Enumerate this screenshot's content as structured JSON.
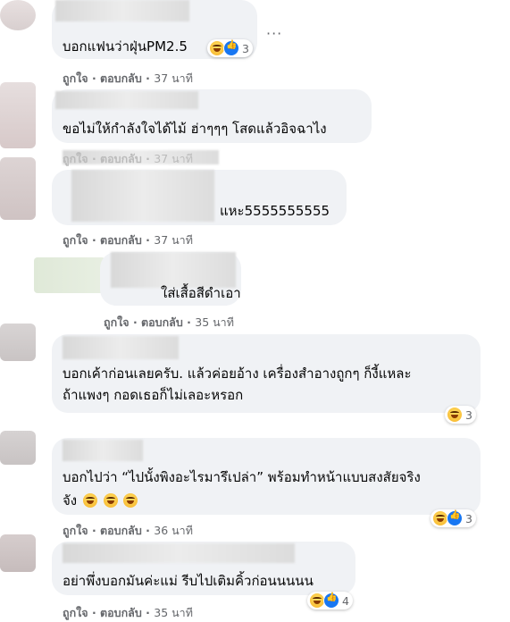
{
  "colors": {
    "bubble": "#f0f2f5",
    "meta": "#65676b",
    "like_blue": "#1877f2",
    "haha_yellow": "#f7b125"
  },
  "comments": [
    {
      "text": "บอกแฟนว่าฝุ่นPM2.5",
      "like_label": "ถูกใจ",
      "reply_label": "ตอบกลับ",
      "time": "37 นาที",
      "reactions": {
        "icons": [
          "haha-icon",
          "like-icon"
        ],
        "count": "3"
      }
    },
    {
      "text": "ขอไม่ให้กำลังใจได้ไม้ ฮ่าๆๆๆ โสดแล้วอิจฉาไง",
      "like_label": "ถูกใจ",
      "reply_label": "ตอบกลับ",
      "time": "37 นาที"
    },
    {
      "text": "แหะ5555555555",
      "like_label": "ถูกใจ",
      "reply_label": "ตอบกลับ",
      "time": "37 นาที"
    },
    {
      "text": "ใส่เสื้อสีดำเอา",
      "like_label": "ถูกใจ",
      "reply_label": "ตอบกลับ",
      "time": "35 นาที"
    },
    {
      "text_line1": "บอกเค้าก่อนเลยครับ. แล้วค่อยอ้าง เครื่องสำอางถูกๆ ก็งี้แหละ",
      "text_line2": "ถ้าแพงๆ กอดเธอก็ไม่เลอะหรอก",
      "reactions": {
        "icons": [
          "haha-icon"
        ],
        "count": "3"
      }
    },
    {
      "text_line1": "บอกไปว่า “ไปนั้งพิงอะไรมารึเปล่า” พร้อมทำหน้าแบบสงสัยจริง",
      "text_line2": "จัง",
      "like_label": "ถูกใจ",
      "reply_label": "ตอบกลับ",
      "time": "36 นาที",
      "reactions": {
        "icons": [
          "haha-icon",
          "like-icon"
        ],
        "count": "3"
      }
    },
    {
      "text": "อย่าพึ่งบอกมันค่ะแม่ รีบไปเติมคิ้วก่อนนนนน",
      "like_label": "ถูกใจ",
      "reply_label": "ตอบกลับ",
      "time": "35 นาที",
      "reactions": {
        "icons": [
          "haha-icon"
        ],
        "count": "4"
      }
    }
  ],
  "separator": "·",
  "more_label": "···"
}
